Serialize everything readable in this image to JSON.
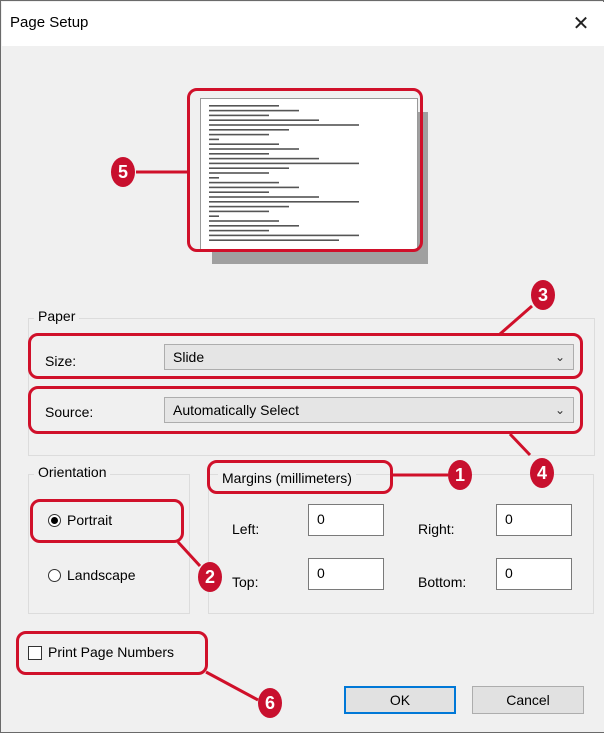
{
  "window": {
    "title": "Page Setup",
    "close_glyph": "✕"
  },
  "paper": {
    "group_label": "Paper",
    "size_label": "Size:",
    "size_value": "Slide",
    "source_label": "Source:",
    "source_value": "Automatically Select"
  },
  "orientation": {
    "group_label": "Orientation",
    "portrait_label": "Portrait",
    "landscape_label": "Landscape",
    "selected": "Portrait"
  },
  "margins": {
    "group_label": "Margins (millimeters)",
    "left_label": "Left:",
    "left_value": "0",
    "right_label": "Right:",
    "right_value": "0",
    "top_label": "Top:",
    "top_value": "0",
    "bottom_label": "Bottom:",
    "bottom_value": "0"
  },
  "print_page_numbers": {
    "label": "Print Page Numbers",
    "checked": false
  },
  "buttons": {
    "ok": "OK",
    "cancel": "Cancel"
  },
  "annotations": {
    "color": "#d0102a",
    "badges": [
      "1",
      "2",
      "3",
      "4",
      "5",
      "6"
    ]
  }
}
